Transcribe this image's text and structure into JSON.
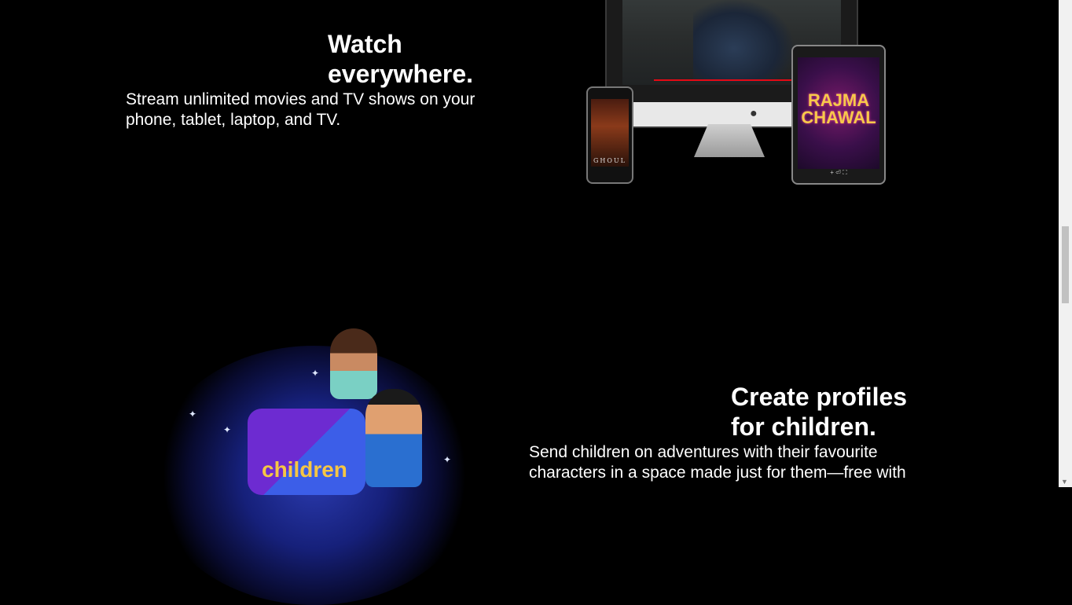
{
  "sections": [
    {
      "title_line1": "Watch",
      "title_line2": "everywhere.",
      "description_line1": "Stream unlimited movies and TV shows on your",
      "description_line2": "phone, tablet, laptop, and TV.",
      "image": {
        "phone_title": "GHOUL",
        "tablet_title_line1": "RAJMA",
        "tablet_title_line2": "CHAWAL",
        "tablet_controls": "+   ⏎   ⛶",
        "apple_logo": ""
      }
    },
    {
      "title_line1": "Create profiles",
      "title_line2": "for children.",
      "description_line1": "Send children on adventures with their favourite",
      "description_line2": "characters in a space made just for them—free with",
      "image": {
        "box_label": "children"
      }
    }
  ],
  "scrollbar": {
    "arrow_down": "▼"
  },
  "colors": {
    "background": "#000000",
    "text": "#ffffff",
    "accent": "#e50914"
  }
}
